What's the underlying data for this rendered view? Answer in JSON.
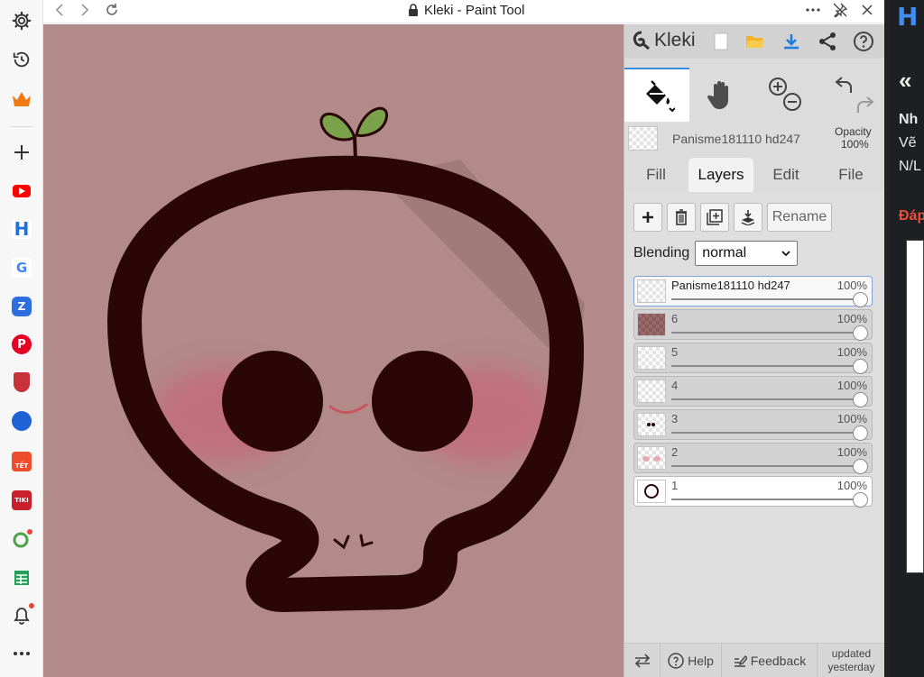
{
  "window": {
    "title": "Kleki - Paint Tool",
    "back_icon": "chevron-left-icon",
    "forward_icon": "chevron-right-icon",
    "reload_icon": "reload-icon",
    "more_icon": "more-horizontal-icon",
    "unpin_icon": "unpin-icon",
    "close_icon": "close-icon"
  },
  "sidebar": {
    "items": [
      {
        "name": "settings",
        "icon": "gear-icon"
      },
      {
        "name": "history",
        "icon": "history-icon"
      },
      {
        "name": "rewards",
        "icon": "crown-icon"
      },
      {
        "name": "add",
        "icon": "plus-icon"
      },
      {
        "name": "youtube",
        "icon": "youtube-icon"
      },
      {
        "name": "hoc",
        "icon": "h-logo-icon"
      },
      {
        "name": "google",
        "icon": "google-icon"
      },
      {
        "name": "zalo",
        "icon": "zalo-icon"
      },
      {
        "name": "pinterest",
        "icon": "pinterest-icon"
      },
      {
        "name": "shield",
        "icon": "shield-icon"
      },
      {
        "name": "app-blue",
        "icon": "blue-app-icon"
      },
      {
        "name": "shopee",
        "icon": "shopee-icon",
        "label": "TẾT"
      },
      {
        "name": "tiki",
        "icon": "tiki-icon",
        "label": "TIKI"
      },
      {
        "name": "app-green",
        "icon": "green-app-icon"
      },
      {
        "name": "sheets",
        "icon": "sheets-icon"
      },
      {
        "name": "notifications",
        "icon": "bell-icon"
      },
      {
        "name": "more",
        "icon": "more-icon"
      }
    ]
  },
  "kleki": {
    "logo_text": "Kleki",
    "header_icons": [
      "new-file-icon",
      "open-folder-icon",
      "download-icon",
      "share-icon",
      "help-icon"
    ],
    "tools": [
      {
        "name": "paint-bucket",
        "icon": "paint-bucket-icon",
        "active": true
      },
      {
        "name": "hand",
        "icon": "hand-icon",
        "active": false
      },
      {
        "name": "zoom",
        "icon": "zoom-icon",
        "active": false
      },
      {
        "name": "undo-redo",
        "icon": "undo-icon",
        "active": false
      }
    ],
    "current_layer": {
      "name": "Panisme181110 hd247",
      "opacity_label": "Opacity",
      "opacity_value": "100%"
    },
    "tabs": [
      {
        "label": "Fill",
        "active": false
      },
      {
        "label": "Layers",
        "active": true
      },
      {
        "label": "Edit",
        "active": false
      },
      {
        "label": "File",
        "active": false
      }
    ],
    "layer_buttons": {
      "rename_label": "Rename"
    },
    "blending": {
      "label": "Blending",
      "value": "normal"
    },
    "layers": [
      {
        "name": "Panisme181110 hd247",
        "opacity": "100%",
        "selected": true,
        "opacity_fraction": 1.0
      },
      {
        "name": "6",
        "opacity": "100%",
        "selected": false,
        "opacity_fraction": 1.0
      },
      {
        "name": "5",
        "opacity": "100%",
        "selected": false,
        "opacity_fraction": 1.0
      },
      {
        "name": "4",
        "opacity": "100%",
        "selected": false,
        "opacity_fraction": 1.0
      },
      {
        "name": "3",
        "opacity": "100%",
        "selected": false,
        "opacity_fraction": 1.0
      },
      {
        "name": "2",
        "opacity": "100%",
        "selected": false,
        "opacity_fraction": 1.0
      },
      {
        "name": "1",
        "opacity": "100%",
        "selected": false,
        "opacity_fraction": 1.0
      }
    ],
    "bottom": {
      "help_label": "Help",
      "feedback_label": "Feedback",
      "updated_line1": "updated",
      "updated_line2": "yesterday"
    }
  },
  "right_page": {
    "logo": "H",
    "chevrons": "«",
    "line1": "Nh",
    "line2": "Vẽ",
    "line3": "N/L",
    "line4": "Đáp"
  },
  "colors": {
    "canvas_bg": "#b18a89",
    "outline": "#2b0606",
    "blush": "#c46a78",
    "leaf": "#79a24a",
    "accent": "#3b8de0"
  }
}
